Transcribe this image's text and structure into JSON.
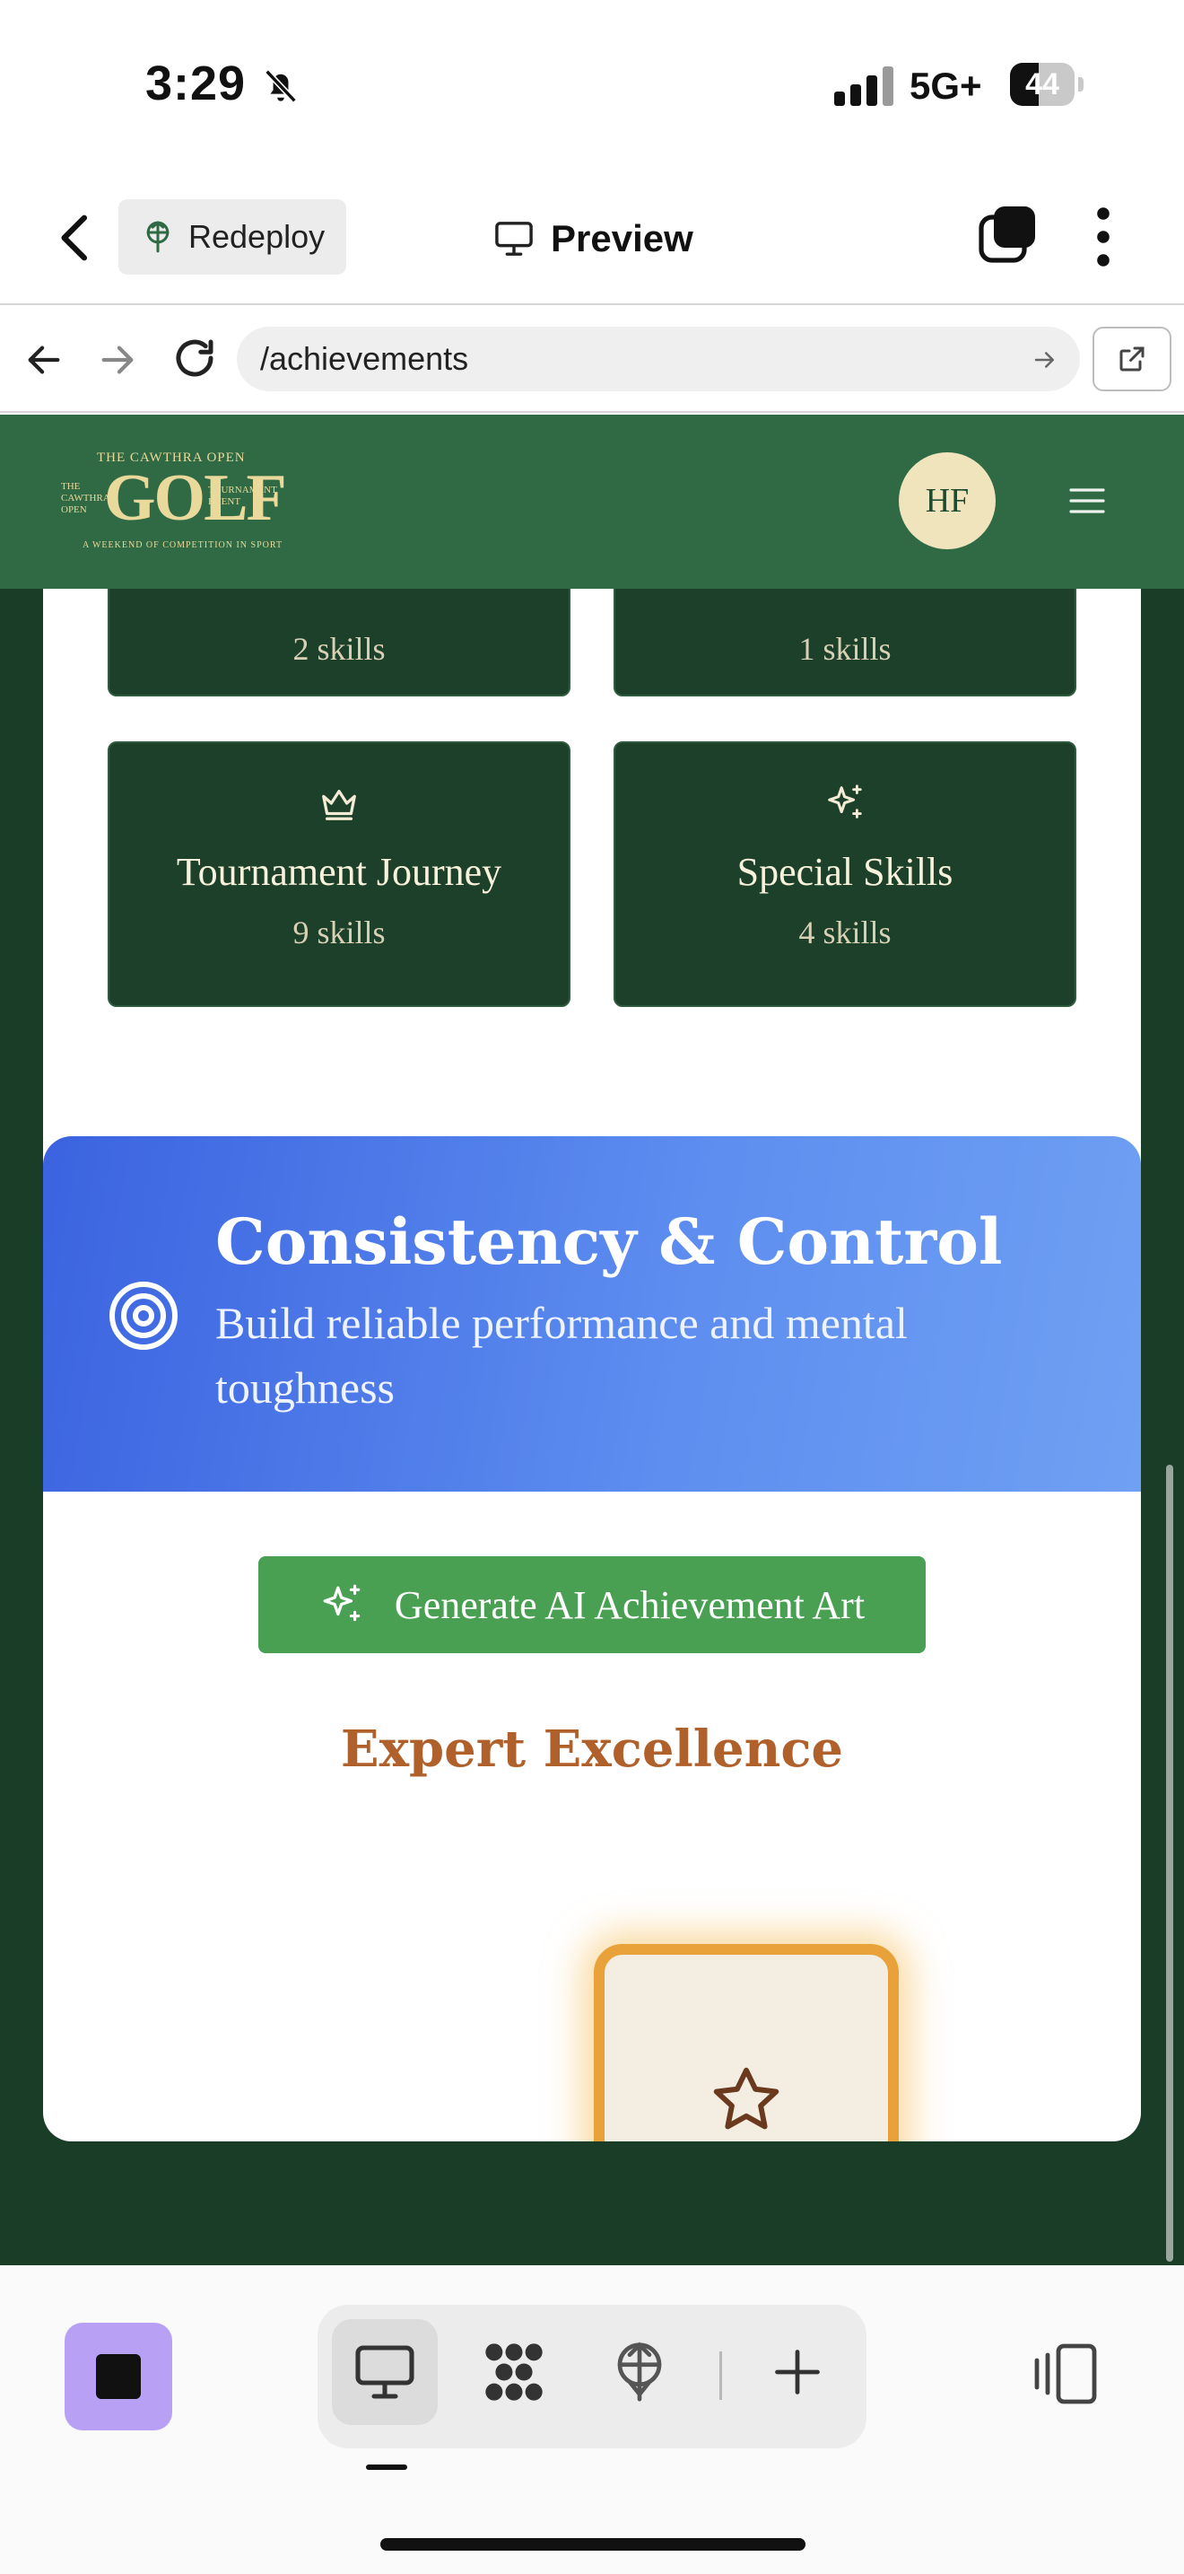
{
  "status_bar": {
    "time": "3:29",
    "network": "5G+",
    "battery": "44",
    "battery_level_fraction": 0.44
  },
  "app_toolbar": {
    "redeploy_label": "Redeploy",
    "preview_label": "Preview"
  },
  "browser": {
    "url": "/achievements"
  },
  "site_header": {
    "logo": {
      "top_line": "THE CAWTHRA OPEN",
      "wordmark": "GOLF",
      "left_stack": "THE CAWTHRA OPEN",
      "right_stack": "TOURNAMENT EVENT",
      "tagline": "A WEEKEND OF COMPETITION IN SPORT"
    },
    "avatar_initials": "HF"
  },
  "skill_groups": [
    {
      "name": "",
      "count": "2 skills",
      "icon": "none"
    },
    {
      "name": "",
      "count": "1 skills",
      "icon": "none"
    },
    {
      "name": "Tournament Journey",
      "count": "9 skills",
      "icon": "crown-icon"
    },
    {
      "name": "Special Skills",
      "count": "4 skills",
      "icon": "sparkles-icon"
    }
  ],
  "category": {
    "title": "Consistency & Control",
    "description": "Build reliable performance and mental toughness",
    "icon": "target-icon",
    "generate_button_label": "Generate AI Achievement Art",
    "tier_title": "Expert Excellence",
    "badge_icon": "star-icon"
  },
  "colors": {
    "header_green": "#2f6a45",
    "page_green": "#1a3d28",
    "tile_green": "#1c4029",
    "banner_blue_start": "#3b63e0",
    "banner_blue_end": "#6fa0f3",
    "button_green": "#4aa052",
    "tier_orange": "#b0602a",
    "badge_gold": "#e9a13a",
    "stop_purple": "#b8a1f5"
  },
  "dock": {
    "items": [
      "monitor-icon",
      "dots-grid-icon",
      "deploy-icon",
      "plus-icon"
    ],
    "active_item": "monitor-icon"
  }
}
